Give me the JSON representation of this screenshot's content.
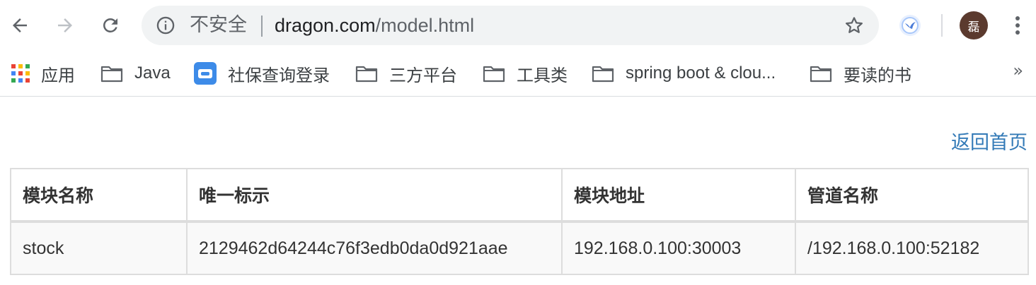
{
  "toolbar": {
    "security_label": "不安全",
    "url_host": "dragon.com",
    "url_path": "/model.html",
    "avatar_text": "磊"
  },
  "bookmarks": [
    {
      "label": "应用",
      "icon": "apps-grid-icon"
    },
    {
      "label": "Java",
      "icon": "folder-icon"
    },
    {
      "label": "社保查询登录",
      "icon": "site-favicon-icon"
    },
    {
      "label": "三方平台",
      "icon": "folder-icon"
    },
    {
      "label": "工具类",
      "icon": "folder-icon"
    },
    {
      "label": "spring boot & clou...",
      "icon": "folder-icon"
    },
    {
      "label": "要读的书",
      "icon": "folder-icon"
    }
  ],
  "bookmarks_more": "»",
  "page": {
    "back_link": "返回首页",
    "table": {
      "headers": [
        "模块名称",
        "唯一标示",
        "模块地址",
        "管道名称"
      ],
      "rows": [
        [
          "stock",
          "2129462d64244c76f3edb0da0d921aae",
          "192.168.0.100:30003",
          "/192.168.0.100:52182"
        ]
      ]
    }
  },
  "colors": {
    "link": "#337ab7",
    "table_border": "#dddddd",
    "row_bg": "#f9f9f9"
  }
}
